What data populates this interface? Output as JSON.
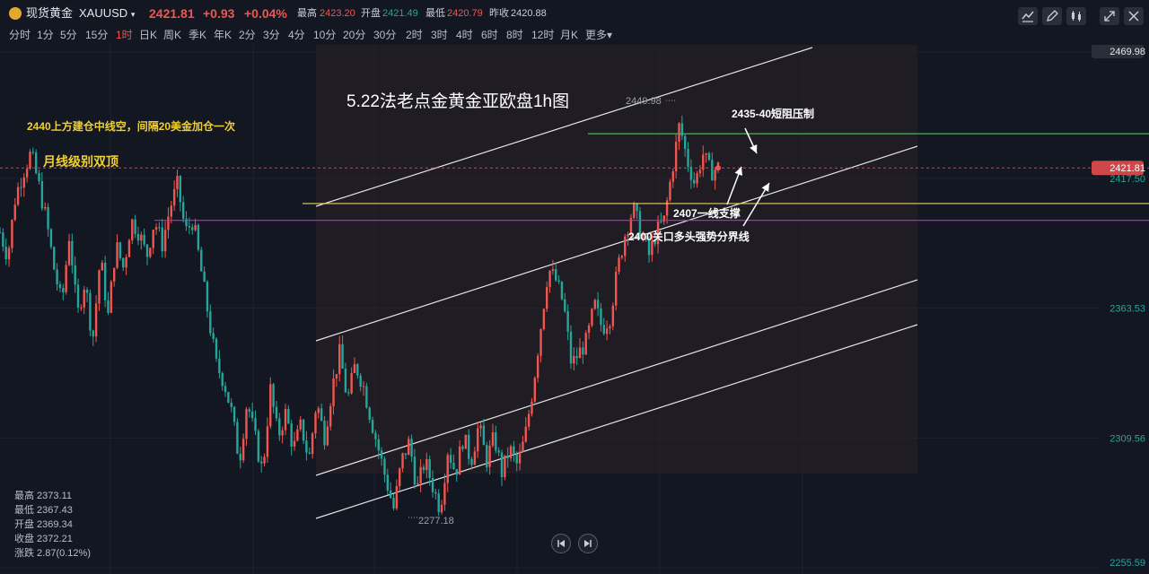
{
  "header": {
    "name": "现货黄金",
    "symbol": "XAUUSD",
    "price": "2421.81",
    "change": "+0.93",
    "change_pct": "+0.04%",
    "high_label": "最高",
    "high": "2423.20",
    "open_label": "开盘",
    "open": "2421.49",
    "low_label": "最低",
    "low": "2420.79",
    "prev_label": "昨收",
    "prev": "2420.88"
  },
  "timeframes": [
    "分时",
    "1分",
    "5分",
    "15分",
    "1时",
    "日K",
    "周K",
    "季K",
    "年K",
    "2分",
    "3分",
    "4分",
    "10分",
    "20分",
    "30分",
    "2时",
    "3时",
    "4时",
    "6时",
    "8时",
    "12时",
    "月K",
    "更多"
  ],
  "active_timeframe": "1时",
  "colors": {
    "up": "#f0564f",
    "down": "#26a69a",
    "bg": "#131722"
  },
  "ohlc_panel": [
    {
      "label": "最高",
      "value": "2373.11"
    },
    {
      "label": "最低",
      "value": "2367.43"
    },
    {
      "label": "开盘",
      "value": "2369.34"
    },
    {
      "label": "收盘",
      "value": "2372.21"
    },
    {
      "label": "涨跌",
      "value": "2.87(0.12%)"
    }
  ],
  "chart_data": {
    "type": "candlestick",
    "title": "5.22法老点金黄金亚欧盘1h图",
    "y_ticks": [
      "2469.98",
      "2417.50",
      "2363.53",
      "2309.56",
      "2255.59"
    ],
    "ylim": [
      2255.59,
      2469.98
    ],
    "current_price_label": "2421.81",
    "top_price_label": "2469.98",
    "high_marker": "2449.98",
    "low_marker": "2277.18",
    "annotations": [
      "2440上方建仓中线空，间隔20美金加仓一次",
      "月线级别双顶",
      "2435-40短阻压制",
      "2407一线支撑",
      "2400关口多头强势分界线"
    ],
    "levels": [
      {
        "price": 2436,
        "color": "#39c24a"
      },
      {
        "price": 2421.81,
        "color": "#d0474a"
      },
      {
        "price": 2407,
        "color": "#e8d060"
      },
      {
        "price": 2400,
        "color": "#d020d0"
      }
    ],
    "close_path": [
      2395,
      2385,
      2410,
      2420,
      2428,
      2415,
      2400,
      2380,
      2365,
      2395,
      2360,
      2375,
      2350,
      2385,
      2360,
      2390,
      2380,
      2400,
      2395,
      2385,
      2400,
      2390,
      2405,
      2415,
      2395,
      2400,
      2380,
      2360,
      2340,
      2333,
      2320,
      2300,
      2325,
      2310,
      2295,
      2330,
      2310,
      2320,
      2305,
      2315,
      2300,
      2325,
      2310,
      2330,
      2345,
      2325,
      2340,
      2332,
      2318,
      2305,
      2292,
      2280,
      2300,
      2308,
      2288,
      2300,
      2290,
      2280,
      2305,
      2295,
      2310,
      2300,
      2315,
      2300,
      2310,
      2295,
      2305,
      2298,
      2310,
      2330,
      2355,
      2380,
      2375,
      2365,
      2340,
      2345,
      2350,
      2365,
      2355,
      2360,
      2380,
      2395,
      2405,
      2395,
      2385,
      2395,
      2400,
      2420,
      2440,
      2425,
      2415,
      2428,
      2420,
      2422
    ],
    "close_x_span": [
      0,
      800
    ]
  }
}
